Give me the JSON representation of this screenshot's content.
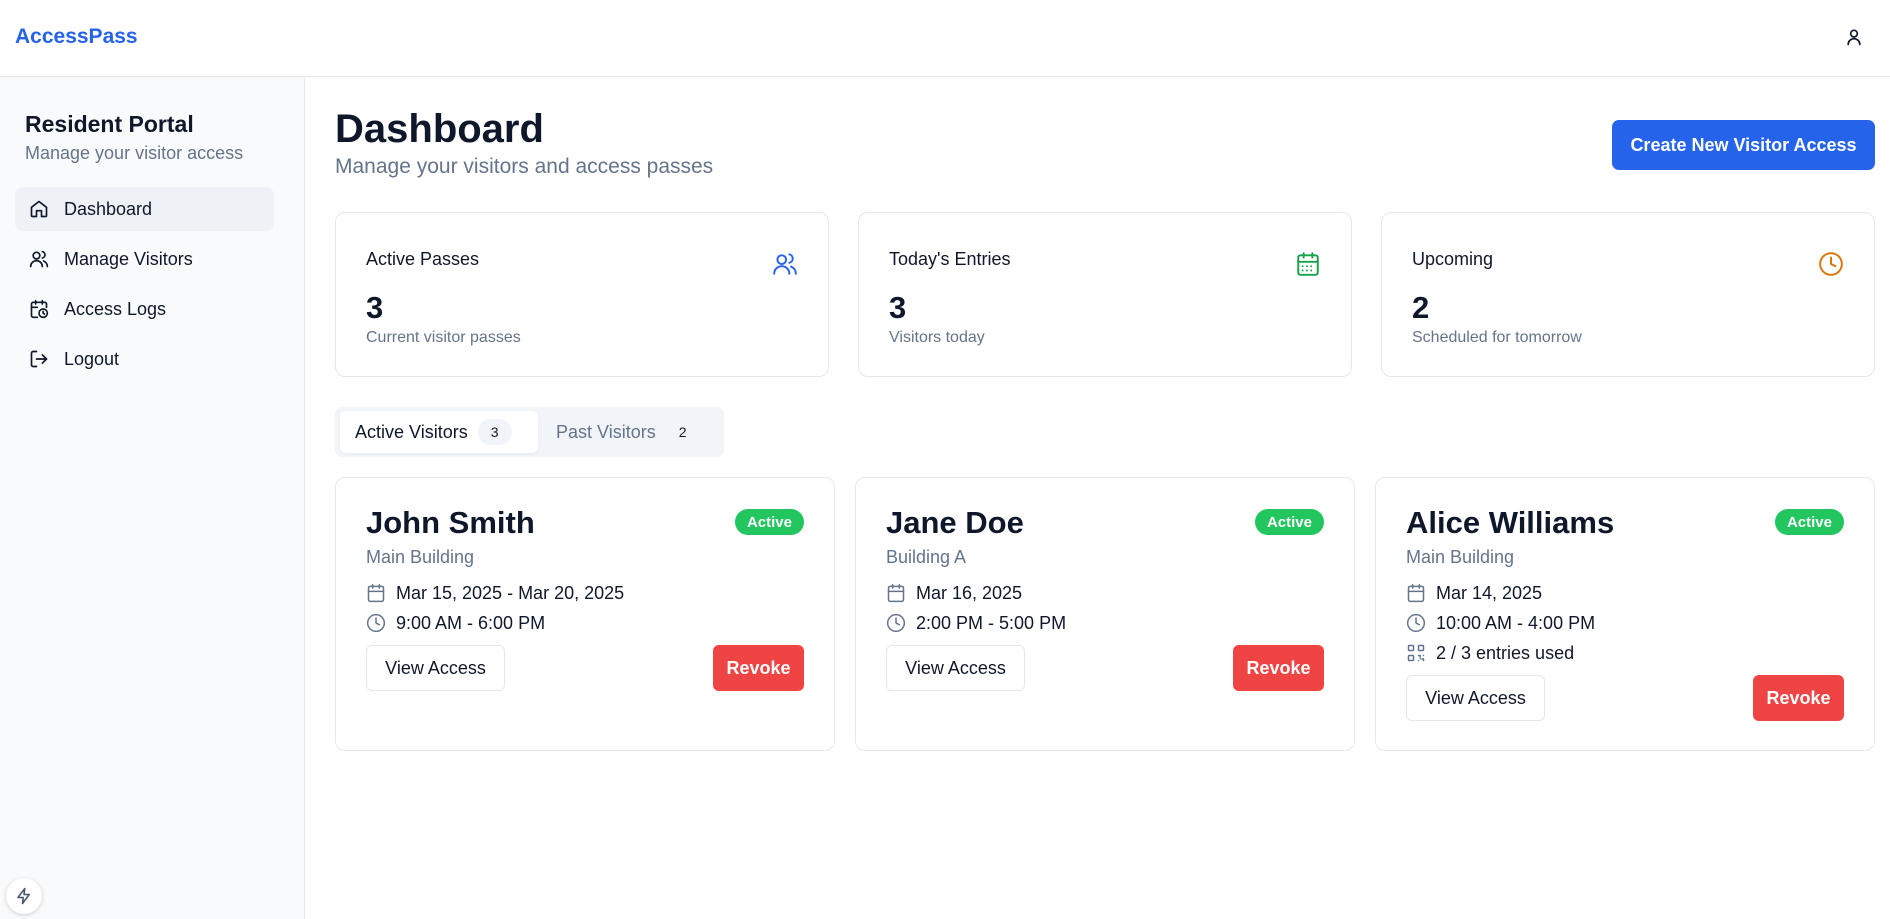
{
  "app": {
    "brand": "AccessPass"
  },
  "header": {
    "user_icon": "user-icon"
  },
  "sidebar": {
    "title": "Resident Portal",
    "subtitle": "Manage your visitor access",
    "items": [
      {
        "label": "Dashboard",
        "icon": "home-icon",
        "active": true
      },
      {
        "label": "Manage Visitors",
        "icon": "users-icon",
        "active": false
      },
      {
        "label": "Access Logs",
        "icon": "calendar-clock-icon",
        "active": false
      },
      {
        "label": "Logout",
        "icon": "logout-icon",
        "active": false
      }
    ],
    "bolt_icon": "bolt-icon"
  },
  "main": {
    "title": "Dashboard",
    "subtitle": "Manage your visitors and access passes",
    "create_button": "Create New Visitor Access",
    "stats": [
      {
        "label": "Active Passes",
        "value": "3",
        "desc": "Current visitor passes",
        "icon": "users-icon",
        "color": "#2563eb"
      },
      {
        "label": "Today's Entries",
        "value": "3",
        "desc": "Visitors today",
        "icon": "calendar-icon",
        "color": "#16a34a"
      },
      {
        "label": "Upcoming",
        "value": "2",
        "desc": "Scheduled for tomorrow",
        "icon": "clock-icon",
        "color": "#d97706"
      }
    ],
    "tabs": [
      {
        "label": "Active Visitors",
        "count": "3",
        "active": true
      },
      {
        "label": "Past Visitors",
        "count": "2",
        "active": false
      }
    ],
    "visitors": [
      {
        "name": "John Smith",
        "location": "Main Building",
        "status": "Active",
        "date": "Mar 15, 2025 - Mar 20, 2025",
        "time": "9:00 AM - 6:00 PM",
        "view": "View Access",
        "revoke": "Revoke"
      },
      {
        "name": "Jane Doe",
        "location": "Building A",
        "status": "Active",
        "date": "Mar 16, 2025",
        "time": "2:00 PM - 5:00 PM",
        "view": "View Access",
        "revoke": "Revoke"
      },
      {
        "name": "Alice Williams",
        "location": "Main Building",
        "status": "Active",
        "date": "Mar 14, 2025",
        "time": "10:00 AM - 4:00 PM",
        "entries": "2 / 3 entries used",
        "view": "View Access",
        "revoke": "Revoke"
      }
    ]
  },
  "colors": {
    "primary": "#2563eb",
    "success": "#22c55e",
    "danger": "#ef4444",
    "muted": "#64748b"
  }
}
